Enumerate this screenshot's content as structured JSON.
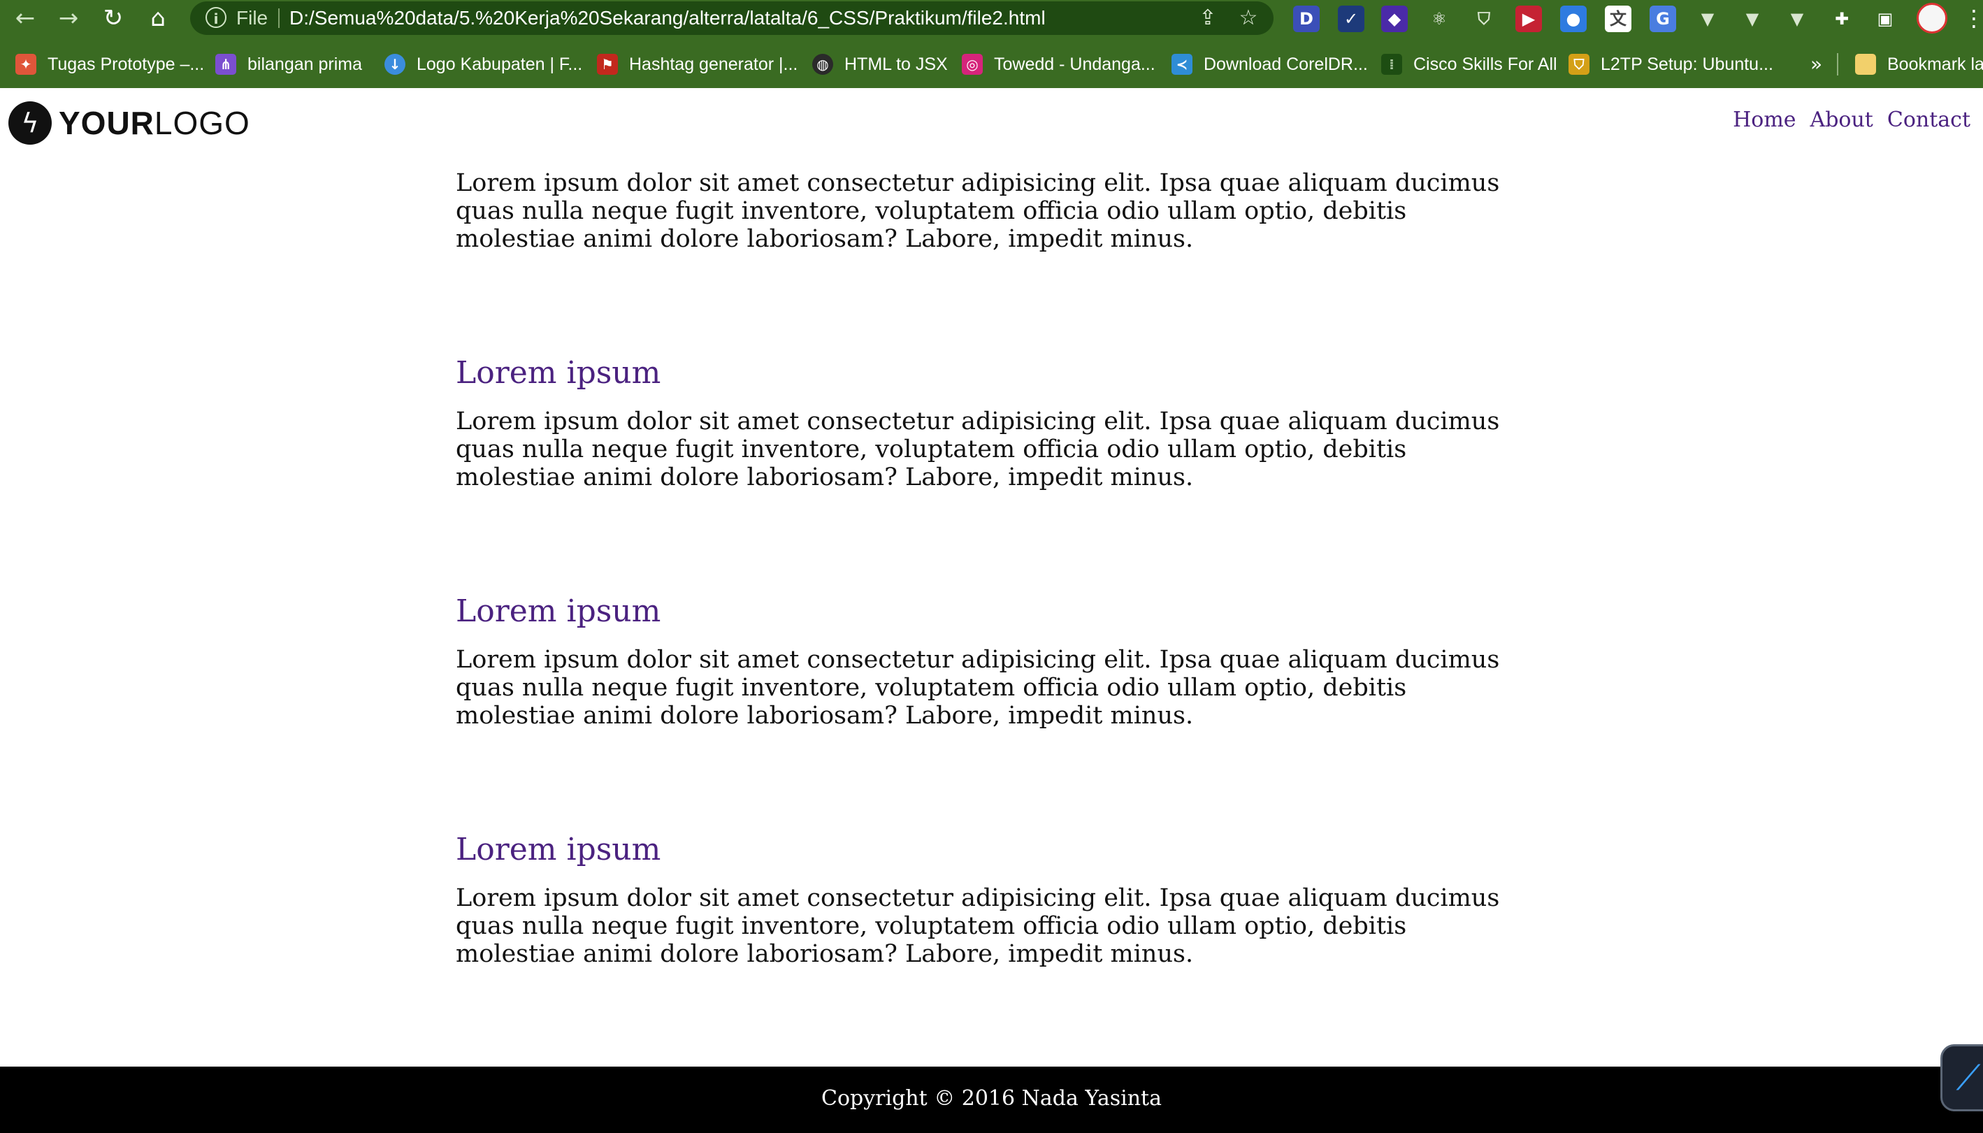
{
  "browser": {
    "address": {
      "scheme_label": "File",
      "url": "D:/Semua%20data/5.%20Kerja%20Sekarang/alterra/latalta/6_CSS/Praktikum/file2.html"
    },
    "bookmarks": [
      {
        "label": "Tugas Prototype –...",
        "icon": "figma-icon",
        "color": "#e0563a"
      },
      {
        "label": "bilangan prima",
        "icon": "tree-icon",
        "color": "#7b4fd0"
      },
      {
        "label": "Logo Kabupaten | F...",
        "icon": "download-icon",
        "color": "#3b8ddd"
      },
      {
        "label": "Hashtag generator |...",
        "icon": "flag-icon",
        "color": "#c2281d"
      },
      {
        "label": "HTML to JSX",
        "icon": "globe-icon",
        "color": "#2a2a2a"
      },
      {
        "label": "Towedd - Undanga...",
        "icon": "instagram-icon",
        "color": "#d6247b"
      },
      {
        "label": "Download CorelDR...",
        "icon": "corel-icon",
        "color": "#2f8dd6"
      },
      {
        "label": "Cisco Skills For All",
        "icon": "cisco-icon",
        "color": "#1d4d12"
      },
      {
        "label": "L2TP Setup: Ubuntu...",
        "icon": "shield-icon",
        "color": "#d4a017"
      }
    ],
    "bookmarks_more": "»",
    "other_bookmarks": "Bookmark lai"
  },
  "site": {
    "logo": {
      "bold": "YOUR",
      "regular": "LOGO"
    },
    "nav": [
      {
        "label": "Home"
      },
      {
        "label": "About"
      },
      {
        "label": "Contact"
      }
    ],
    "intro": "Lorem ipsum dolor sit amet consectetur adipisicing elit. Ipsa quae aliquam ducimus quas nulla neque fugit inventore, voluptatem officia odio ullam optio, debitis molestiae animi dolore laboriosam? Labore, impedit minus.",
    "sections": [
      {
        "heading": "Lorem ipsum",
        "body": "Lorem ipsum dolor sit amet consectetur adipisicing elit. Ipsa quae aliquam ducimus quas nulla neque fugit inventore, voluptatem officia odio ullam optio, debitis molestiae animi dolore laboriosam? Labore, impedit minus."
      },
      {
        "heading": "Lorem ipsum",
        "body": "Lorem ipsum dolor sit amet consectetur adipisicing elit. Ipsa quae aliquam ducimus quas nulla neque fugit inventore, voluptatem officia odio ullam optio, debitis molestiae animi dolore laboriosam? Labore, impedit minus."
      },
      {
        "heading": "Lorem ipsum",
        "body": "Lorem ipsum dolor sit amet consectetur adipisicing elit. Ipsa quae aliquam ducimus quas nulla neque fugit inventore, voluptatem officia odio ullam optio, debitis molestiae animi dolore laboriosam? Labore, impedit minus."
      }
    ],
    "footer": {
      "copyright": "Copyright © 2016 Nada Yasinta"
    }
  },
  "colors": {
    "chrome": "#3a6b22",
    "accent": "#4b2280",
    "footer": "#000000"
  }
}
